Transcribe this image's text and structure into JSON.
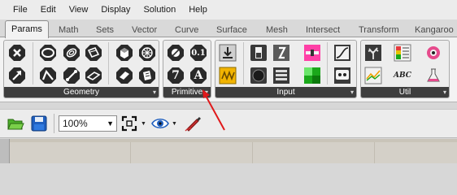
{
  "menu": [
    "File",
    "Edit",
    "View",
    "Display",
    "Solution",
    "Help"
  ],
  "tabs": [
    "Params",
    "Math",
    "Sets",
    "Vector",
    "Curve",
    "Surface",
    "Mesh",
    "Intersect",
    "Transform",
    "Kangaroo"
  ],
  "groups": {
    "geometry": "Geometry",
    "primitive": "Primitive",
    "input": "Input",
    "util": "Util"
  },
  "icons": {
    "geometry": [
      "point-icon",
      "circle-icon",
      "arc-icon",
      "box-icon",
      "brep-icon",
      "mesh-icon",
      "vector-icon",
      "curve-icon",
      "line-icon",
      "plane-icon",
      "surface-icon",
      "field-icon"
    ],
    "primitive_text": {
      "integer": "7",
      "text": "A",
      "number": "0.1"
    },
    "input": [
      "gene-pool-icon",
      "toggle-icon",
      "button-icon",
      "graph-mapper-icon",
      "slider-icon",
      "knob-icon",
      "value-list-icon",
      "digit-scroller-icon",
      "md-slider-icon",
      "color-swatch-icon",
      "panel-icon"
    ],
    "util_text": {
      "abc": "ABC"
    },
    "util": [
      "tree-icon",
      "gradient-icon",
      "color-wheel-icon",
      "quick-graph-icon",
      "flask-icon"
    ]
  },
  "toolbar": {
    "zoom": "100%",
    "buttons": [
      "open-icon",
      "save-icon",
      "zoom-extents-icon",
      "preview-eye-icon",
      "sketch-icon"
    ]
  },
  "colors": {
    "annotation": "#e0191b",
    "group_label_bg": "#3e3e3e"
  }
}
